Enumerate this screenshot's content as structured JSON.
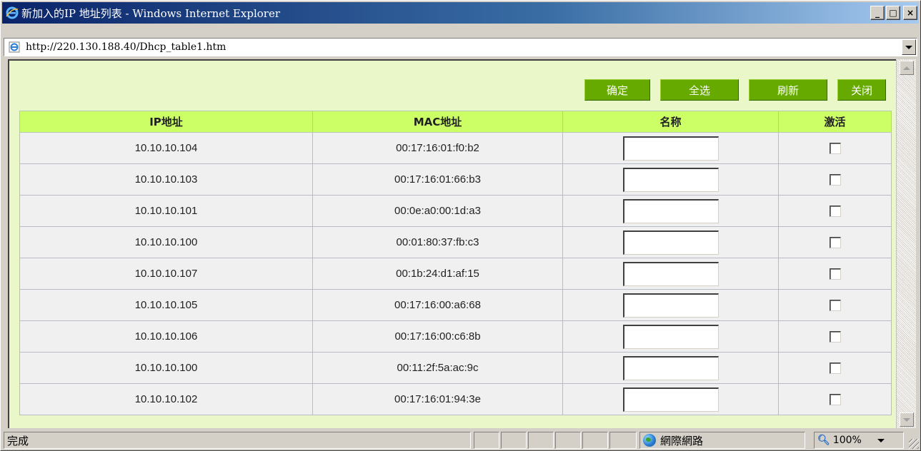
{
  "window": {
    "title": "新加入的IP 地址列表 - Windows Internet Explorer",
    "caption_buttons": {
      "minimize": "_",
      "maximize": "□",
      "close": "×"
    }
  },
  "address": {
    "url": "http://220.130.188.40/Dhcp_table1.htm"
  },
  "toolbar": {
    "ok_label": "确定",
    "select_all_label": "全选",
    "refresh_label": "刷新",
    "close_label": "关闭"
  },
  "table": {
    "headers": [
      "IP地址",
      "MAC地址",
      "名称",
      "激活"
    ],
    "rows": [
      {
        "ip": "10.10.10.104",
        "mac": "00:17:16:01:f0:b2",
        "name": "",
        "active": false
      },
      {
        "ip": "10.10.10.103",
        "mac": "00:17:16:01:66:b3",
        "name": "",
        "active": false
      },
      {
        "ip": "10.10.10.101",
        "mac": "00:0e:a0:00:1d:a3",
        "name": "",
        "active": false
      },
      {
        "ip": "10.10.10.100",
        "mac": "00:01:80:37:fb:c3",
        "name": "",
        "active": false
      },
      {
        "ip": "10.10.10.107",
        "mac": "00:1b:24:d1:af:15",
        "name": "",
        "active": false
      },
      {
        "ip": "10.10.10.105",
        "mac": "00:17:16:00:a6:68",
        "name": "",
        "active": false
      },
      {
        "ip": "10.10.10.106",
        "mac": "00:17:16:00:c6:8b",
        "name": "",
        "active": false
      },
      {
        "ip": "10.10.10.100",
        "mac": "00:11:2f:5a:ac:9c",
        "name": "",
        "active": false
      },
      {
        "ip": "10.10.10.102",
        "mac": "00:17:16:01:94:3e",
        "name": "",
        "active": false
      }
    ]
  },
  "statusbar": {
    "status_text": "完成",
    "zone_text": "網際網路",
    "zoom_text": "100%"
  },
  "colors": {
    "title_gradient_start": "#0a246a",
    "button_green": "#66aa00",
    "header_green": "#ccff66",
    "content_bg": "#eaf7c8"
  },
  "icons": {
    "title": "ie-logo-icon",
    "address": "page-icon",
    "zone": "globe-icon",
    "zoom": "zoom-icon"
  }
}
